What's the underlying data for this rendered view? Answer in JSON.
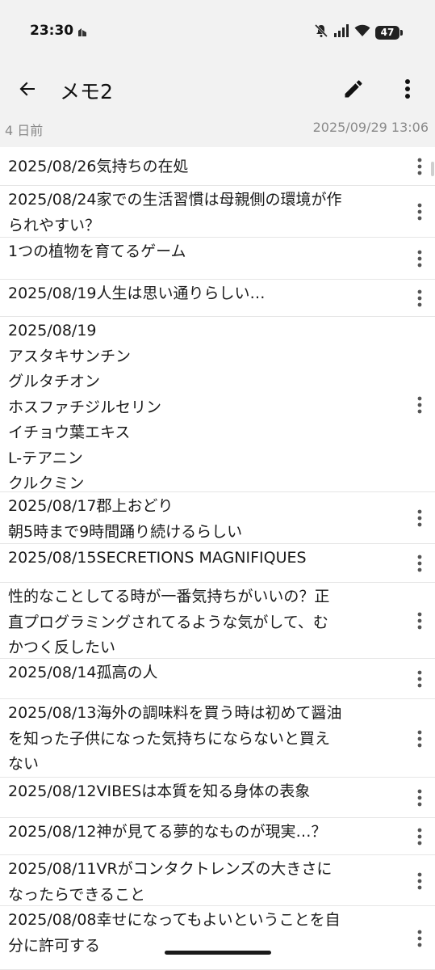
{
  "status_bar": {
    "time": "23:30",
    "battery": "47",
    "icons": [
      "notification-icon",
      "mute-icon",
      "signal-icon",
      "wifi-icon",
      "battery-icon"
    ]
  },
  "app_bar": {
    "title": "メモ2",
    "icons": [
      "back-arrow-icon",
      "edit-pencil-icon",
      "more-vert-icon"
    ]
  },
  "meta": {
    "relative": "4 日前",
    "datetime": "2025/09/29 13:06"
  },
  "memos": [
    {
      "text": "2025/08/26気持ちの在処"
    },
    {
      "text": "2025/08/24家での生活習慣は母親側の環境が作\nられやすい？"
    },
    {
      "text": "1つの植物を育てるゲーム"
    },
    {
      "text": "2025/08/19人生は思い通りらしい…"
    },
    {
      "text": "2025/08/19\nアスタキサンチン\nグルタチオン\nホスファチジルセリン\nイチョウ葉エキス\nL-テアニン\nクルクミン"
    },
    {
      "text": "2025/08/17郡上おどり\n朝5時まで9時間踊り続けるらしい"
    },
    {
      "text": "2025/08/15SECRETIONS MAGNIFIQUES"
    },
    {
      "text": "性的なことしてる時が一番気持ちがいいの？正\n直プログラミングされてるような気がして、む\nかつく反したい"
    },
    {
      "text": "2025/08/14孤高の人"
    },
    {
      "text": "2025/08/13海外の調味料を買う時は初めて醤油\nを知った子供になった気持ちにならないと買え\nない"
    },
    {
      "text": "2025/08/12VIBESは本質を知る身体の表象"
    },
    {
      "text": "2025/08/12神が見てる夢的なものが現実…？"
    },
    {
      "text": "2025/08/11VRがコンタクトレンズの大きさに\nなったらできること"
    },
    {
      "text": "2025/08/08幸せになってもよいということを自\n分に許可する"
    }
  ]
}
